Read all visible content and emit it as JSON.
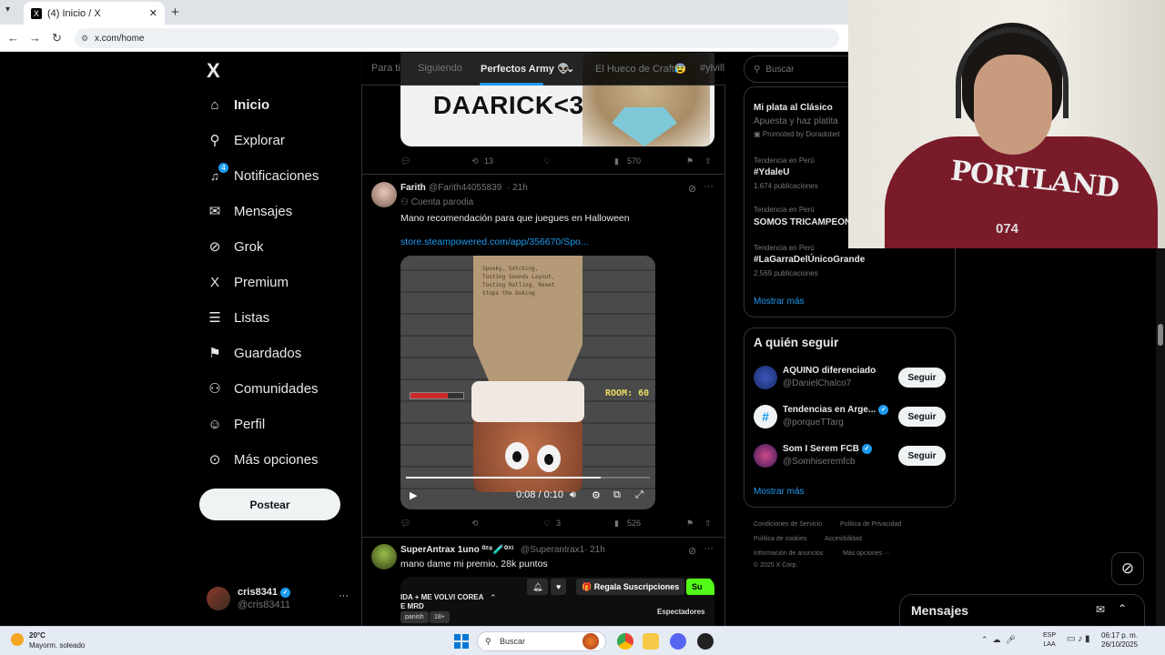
{
  "browser": {
    "tab_title": "(4) Inicio / X",
    "tab_close": "✕",
    "new_tab": "+",
    "url": "x.com/home"
  },
  "nav": {
    "logo": "X",
    "items": [
      {
        "label": "Inicio",
        "icon": "home-icon",
        "glyph": "⌂"
      },
      {
        "label": "Explorar",
        "icon": "search-icon",
        "glyph": "⚲"
      },
      {
        "label": "Notificaciones",
        "icon": "bell-icon",
        "glyph": "🔔",
        "badge": "4"
      },
      {
        "label": "Mensajes",
        "icon": "mail-icon",
        "glyph": "✉"
      },
      {
        "label": "Grok",
        "icon": "grok-icon",
        "glyph": "⊘"
      },
      {
        "label": "Premium",
        "icon": "x-icon",
        "glyph": "X"
      },
      {
        "label": "Listas",
        "icon": "list-icon",
        "glyph": "☰"
      },
      {
        "label": "Guardados",
        "icon": "bookmark-icon",
        "glyph": "⚑"
      },
      {
        "label": "Comunidades",
        "icon": "people-icon",
        "glyph": "⚇"
      },
      {
        "label": "Perfil",
        "icon": "person-icon",
        "glyph": "☺"
      },
      {
        "label": "Más opciones",
        "icon": "more-circle-icon",
        "glyph": "⊙"
      }
    ],
    "post_button": "Postear",
    "profile": {
      "name": "cris8341",
      "handle": "@cris83411",
      "more": "···"
    }
  },
  "feed": {
    "tabs": [
      "Para ti",
      "Siguiendo",
      "Perfectos Army 👽",
      "El Hueco de Craft😰",
      "#ylvill"
    ],
    "tweet1": {
      "image_text": "DAARICK<3",
      "replies": "",
      "retweets": "13",
      "likes": "",
      "views": "570"
    },
    "tweet2": {
      "name": "Farith",
      "handle": "@Farith44055839",
      "time": "21h",
      "parody": "Cuenta parodia",
      "text": "Mano recomendación para que juegues en Halloween",
      "link": "store.steampowered.com/app/356670/Spo...",
      "video_room": "ROOM: 60",
      "video_time": "0:08 / 0:10",
      "video_progress": 0.8,
      "paper_text": "Spooky, Sotching, Tosting Sounds Layout, Tosting Rolling, Reset Stops the Doking",
      "retweets": "",
      "likes": "3",
      "views": "526"
    },
    "tweet3": {
      "name": "SuperAntrax 1uno ⁰²⁸🧪⁰³¹",
      "handle": "@Superantrax1",
      "time": "21h",
      "text": "mano dame mi premio, 28k puntos",
      "stream_line1": "IDA + ME VOLVI COREA",
      "stream_line2": "E MRD",
      "chip1": "panish",
      "chip2": "18+",
      "gift": "🎁 Regala Suscripciones",
      "sub": "Su",
      "spectators": "Espectadores"
    }
  },
  "right": {
    "search_placeholder": "Buscar",
    "trends": [
      {
        "top": "",
        "title": "Mi plata al Clásico",
        "sub": "Apuesta y haz platita",
        "meta": "Promoted by Doradobet"
      },
      {
        "top": "Tendencia en Perú",
        "title": "#YdaleU",
        "sub": "1.674 publicaciones"
      },
      {
        "top": "Tendencia en Perú",
        "title": "SOMOS TRICAMPEONES",
        "sub": ""
      },
      {
        "top": "Tendencia en Perú",
        "title": "#LaGarraDelÚnicoGrande",
        "sub": "2.569 publicaciones"
      }
    ],
    "show_more": "Mostrar más",
    "who_to_follow": "A quién seguir",
    "follow": [
      {
        "name": "AQUINO diferenciado",
        "handle": "@DanielChalco7",
        "verified": false
      },
      {
        "name": "Tendencias en Arge...",
        "handle": "@porqueTTarg",
        "verified": true
      },
      {
        "name": "Som I Serem FCB",
        "handle": "@Somhiseremfcb",
        "verified": true
      }
    ],
    "follow_button": "Seguir",
    "show_more2": "Mostrar más",
    "footer": [
      "Condiciones de Servicio",
      "Política de Privacidad",
      "Política de cookies",
      "Accesibilidad",
      "Información de anuncios",
      "Más opciones ···",
      "© 2025 X Corp."
    ],
    "messages": "Mensajes"
  },
  "webcam": {
    "shirt_text": "PORTLAND",
    "shirt_number": "074"
  },
  "taskbar": {
    "temp": "20°C",
    "weather": "Mayorm. soleado",
    "search": "Buscar",
    "lang1": "ESP",
    "lang2": "LAA",
    "time": "06:17 p. m.",
    "date": "26/10/2025"
  }
}
